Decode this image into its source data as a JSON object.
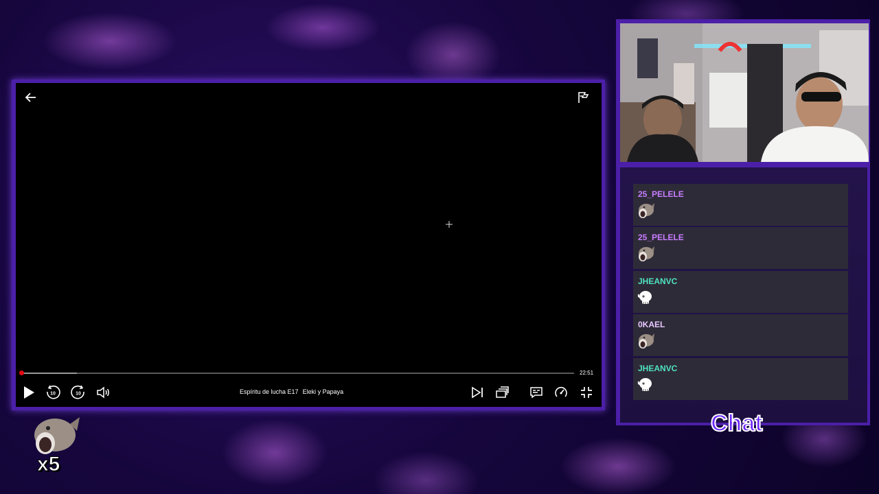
{
  "player": {
    "episode_title": "Espíritu de lucha E17",
    "episode_name": "Eleki y Papaya",
    "time_remaining": "22:51",
    "progress": 0.1,
    "played_indicator": 0.0,
    "accent_color": "#e50914",
    "icons": [
      "back-arrow-icon",
      "flag-icon",
      "play-icon",
      "rewind-10-icon",
      "forward-10-icon",
      "volume-icon",
      "next-episode-icon",
      "episodes-icon",
      "subtitles-icon",
      "playback-speed-icon",
      "exit-fullscreen-icon"
    ],
    "skip_seconds_back": "10",
    "skip_seconds_forward": "10"
  },
  "chat": {
    "title": "Chat",
    "messages": [
      {
        "user": "25_PELELE",
        "color": "#c77dff",
        "emote": "fish-emote"
      },
      {
        "user": "25_PELELE",
        "color": "#c77dff",
        "emote": "fish-emote"
      },
      {
        "user": "JHEANVC",
        "color": "#4fe3c1",
        "emote": "skull-emote"
      },
      {
        "user": "0KAEL",
        "color": "#e6c8ff",
        "emote": "fish-emote"
      },
      {
        "user": "JHEANVC",
        "color": "#4fe3c1",
        "emote": "skull-emote"
      }
    ]
  },
  "combo": {
    "count": "x5",
    "emote": "fish-emote"
  },
  "theme": {
    "frame_color": "#4b1fa8",
    "background": "#16063d"
  }
}
